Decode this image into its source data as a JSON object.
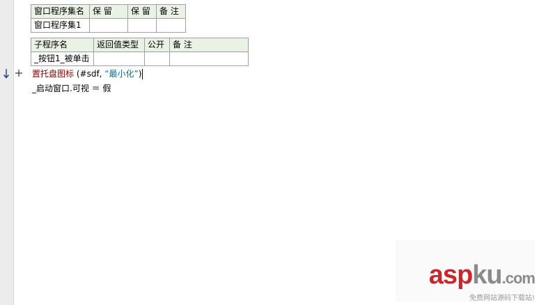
{
  "window_table": {
    "headers": [
      "窗口程序集名",
      "保 留",
      "保 留",
      "备 注"
    ],
    "row": [
      "窗口程序集1",
      "",
      "",
      ""
    ]
  },
  "sub_table": {
    "headers": [
      "子程序名",
      "返回值类型",
      "公开",
      "备 注"
    ],
    "row": [
      "_按钮1_被单击",
      "",
      "",
      ""
    ]
  },
  "code": {
    "line1": {
      "func": "置托盘图标",
      "open": " (",
      "arg1": "#sdf, ",
      "str": "“最小化”",
      "close": ")"
    },
    "line2": "_启动窗口.可视 ＝ 假"
  },
  "watermark": {
    "brand_a": "asp",
    "brand_b": "ku",
    "suffix": ".com",
    "sub": "免费网站源码下载站!"
  },
  "icons": {
    "gutter_arrow": "down-arrow-icon",
    "expand": "plus-icon"
  },
  "colors": {
    "header_bg": "#e9f2e5",
    "func": "#8b0000",
    "string": "#0a6e8a",
    "brand_red": "#c8282d"
  }
}
